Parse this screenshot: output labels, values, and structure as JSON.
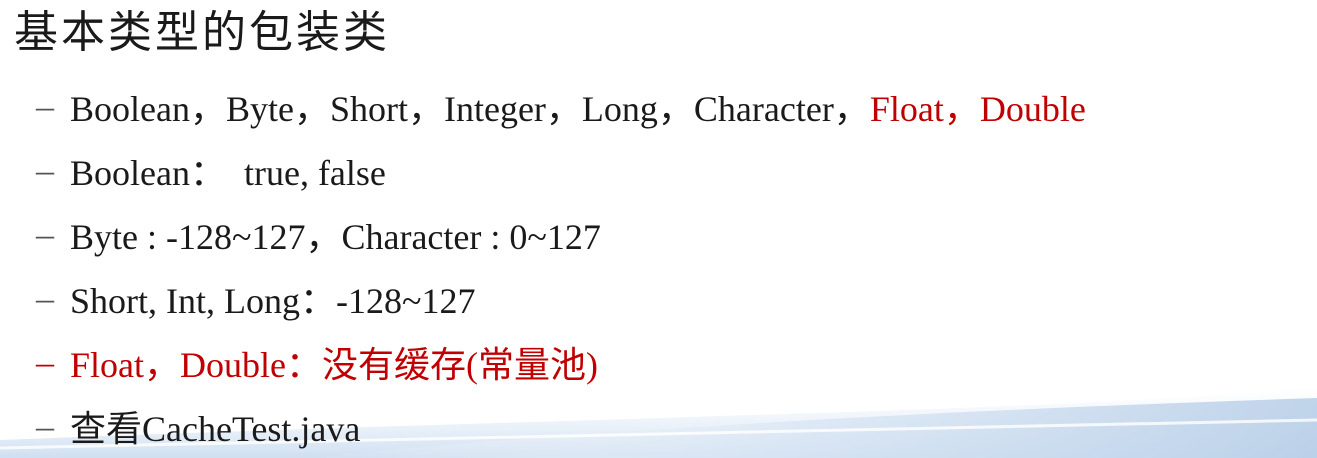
{
  "slide": {
    "title": "基本类型的包装类",
    "dash": "–",
    "bullets": [
      {
        "prefix": "Boolean，Byte，Short，Integer，Long，Character，",
        "highlight": "Float，Double"
      },
      {
        "text": "Boolean：  true, false"
      },
      {
        "text": "Byte : -128~127，Character : 0~127"
      },
      {
        "text": "Short, Int, Long：-128~127"
      },
      {
        "text": "Float，Double：没有缓存(常量池)"
      },
      {
        "text": "查看CacheTest.java"
      }
    ]
  },
  "colors": {
    "text": "#1a1a1a",
    "accent_red": "#c00000",
    "wave_blue": "#c9dbef"
  }
}
